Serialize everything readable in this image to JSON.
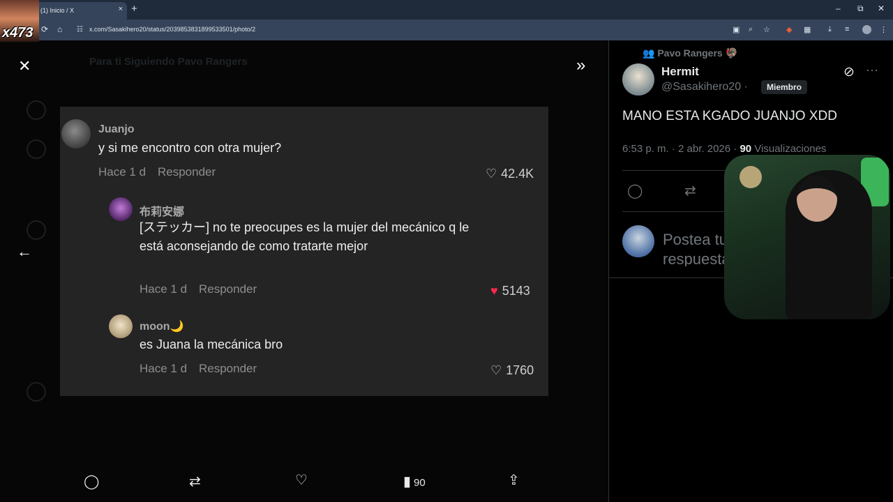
{
  "browser": {
    "tab_title": "(1) Inicio / X",
    "tab_close": "×",
    "new_tab": "+",
    "url": "x.com/Sasakihero20/status/2039853831899533501/photo/2",
    "window_min": "–",
    "window_max": "⧉",
    "window_close": "✕"
  },
  "overlay": {
    "streamer_text": "x473"
  },
  "viewer": {
    "close_icon": "✕",
    "expand_icon": "»",
    "back_icon": "←",
    "bg_tabs": "Para ti    Siguiendo    Pavo Rangers"
  },
  "photo": {
    "comments": [
      {
        "name": "Juanjo",
        "text": "y si me encontro con otra mujer?",
        "time": "Hace 1 d",
        "reply": "Responder",
        "likes": "42.4K",
        "liked": false
      },
      {
        "name": "布莉安娜",
        "text": "[ステッカー] no te preocupes es la mujer del mecánico q le está aconsejando de como tratarte mejor",
        "time": "Hace 1 d",
        "reply": "Responder",
        "likes": "5143",
        "liked": true
      },
      {
        "name": "moon🌙",
        "text": "es Juana la mecánica bro",
        "time": "Hace 1 d",
        "reply": "Responder",
        "likes": "1760",
        "liked": false
      }
    ]
  },
  "actions": {
    "views": "90"
  },
  "panel": {
    "community": "Pavo Rangers 🦃",
    "name": "Hermit",
    "handle": "@Sasakihero20 ·",
    "badge": "Miembro",
    "post_text": "MANO ESTA KGADO JUANJO XDD",
    "time": "6:53 p. m. · 2 abr. 2026 ·",
    "views_count": "90",
    "views_label": "Visualizaciones",
    "reply_placeholder": "Postea tu respuesta"
  },
  "colors": {
    "like_red": "#f91880",
    "accent": "#e7e9ea",
    "muted": "#71767b"
  }
}
